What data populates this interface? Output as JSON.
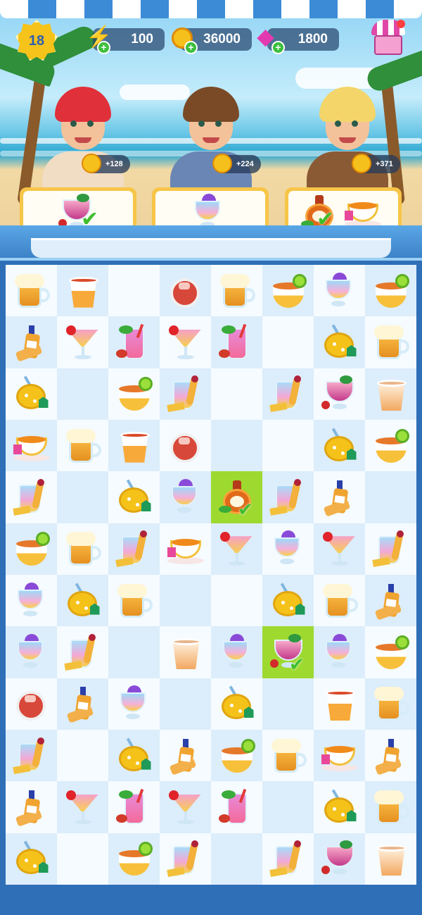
{
  "hud": {
    "level": "18",
    "energy": "100",
    "coins": "36000",
    "gems": "1800",
    "plus": "+"
  },
  "customers": [
    {
      "reward": "+128",
      "order_done": true,
      "hair_color": "#e0303a",
      "shirt_color": "#f1dcc4"
    },
    {
      "reward": "+224",
      "order_done": false,
      "hair_color": "#7a4a26",
      "shirt_color": "#6a86b4"
    },
    {
      "reward": "+371",
      "order_done": true,
      "hair_color": "#f3d56a",
      "shirt_color": "#8a5a34"
    }
  ],
  "colors": {
    "board_light": "#f5fbff",
    "board_dark": "#dcedfb",
    "selected": "#9ed930",
    "frame": "#2f6fb8",
    "check": "#3fbf2e"
  },
  "check_glyph": "✔",
  "board": [
    [
      "mug",
      "cup",
      "",
      "jar",
      "mug",
      "bowl",
      "blue",
      "bowl"
    ],
    [
      "bottle",
      "mart",
      "tall",
      "mart",
      "tall",
      "",
      "teapot",
      "mug"
    ],
    [
      "teapot",
      "",
      "bowl",
      "iced",
      "",
      "iced",
      "punch",
      "cup-empty"
    ],
    [
      "tea",
      "mug",
      "cup",
      "jar",
      "",
      "",
      "teapot",
      "bowl"
    ],
    [
      "iced",
      "",
      "teapot",
      "blue",
      "flask!",
      "iced",
      "bottle",
      ""
    ],
    [
      "bowl",
      "mug",
      "iced",
      "tea",
      "mart",
      "blue",
      "mart",
      "iced"
    ],
    [
      "blue",
      "teapot",
      "mug",
      "",
      "",
      "teapot",
      "mug",
      "bottle"
    ],
    [
      "blue",
      "iced",
      "",
      "cup-empty",
      "blue",
      "punch!",
      "blue",
      "bowl"
    ],
    [
      "jar",
      "bottle",
      "blue",
      "",
      "teapot",
      "",
      "cup",
      "mug"
    ],
    [
      "iced",
      "",
      "teapot",
      "bottle",
      "bowl",
      "mug",
      "tea",
      "bottle"
    ],
    [
      "bottle",
      "mart",
      "tall",
      "mart",
      "tall",
      "",
      "teapot",
      "mug"
    ],
    [
      "teapot",
      "",
      "bowl",
      "iced",
      "",
      "iced",
      "punch",
      "cup-empty"
    ]
  ]
}
